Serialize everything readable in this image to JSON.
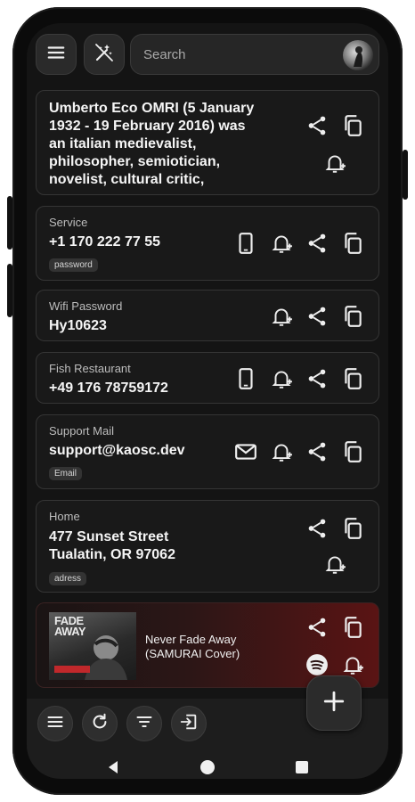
{
  "search": {
    "placeholder": "Search"
  },
  "cards": [
    {
      "type": "quote",
      "text": "Umberto Eco OMRI (5 January 1932 - 19 February 2016) was an italian medievalist, philosopher, semiotician, novelist, cultural critic,"
    },
    {
      "label": "Service",
      "value": "+1 170 222 77 55",
      "tag": "password"
    },
    {
      "label": "Wifi Password",
      "value": "Hy10623"
    },
    {
      "label": "Fish Restaurant",
      "value": "+49 176 78759172"
    },
    {
      "label": "Support Mail",
      "value": "support@kaosc.dev",
      "tag": "Email"
    },
    {
      "label": "Home",
      "value_line1": "477 Sunset Street",
      "value_line2": "Tualatin, OR 97062",
      "tag": "adress"
    }
  ],
  "music": {
    "cover_text_line1": "FADE",
    "cover_text_line2": "AWAY",
    "title_line1": "Never Fade Away",
    "title_line2": "(SAMURAI Cover)"
  },
  "icons": {
    "menu": "menu-icon",
    "magic": "wand-icon",
    "share": "share-icon",
    "copy": "copy-icon",
    "bell": "bell-plus-icon",
    "phone": "phone-icon",
    "mail": "mail-icon",
    "spotify": "spotify-icon",
    "refresh": "refresh-icon",
    "filter": "filter-icon",
    "import": "import-icon",
    "add": "plus-icon"
  },
  "colors": {
    "background": "#141414",
    "card": "#191919",
    "accent_red": "#5a1414"
  }
}
